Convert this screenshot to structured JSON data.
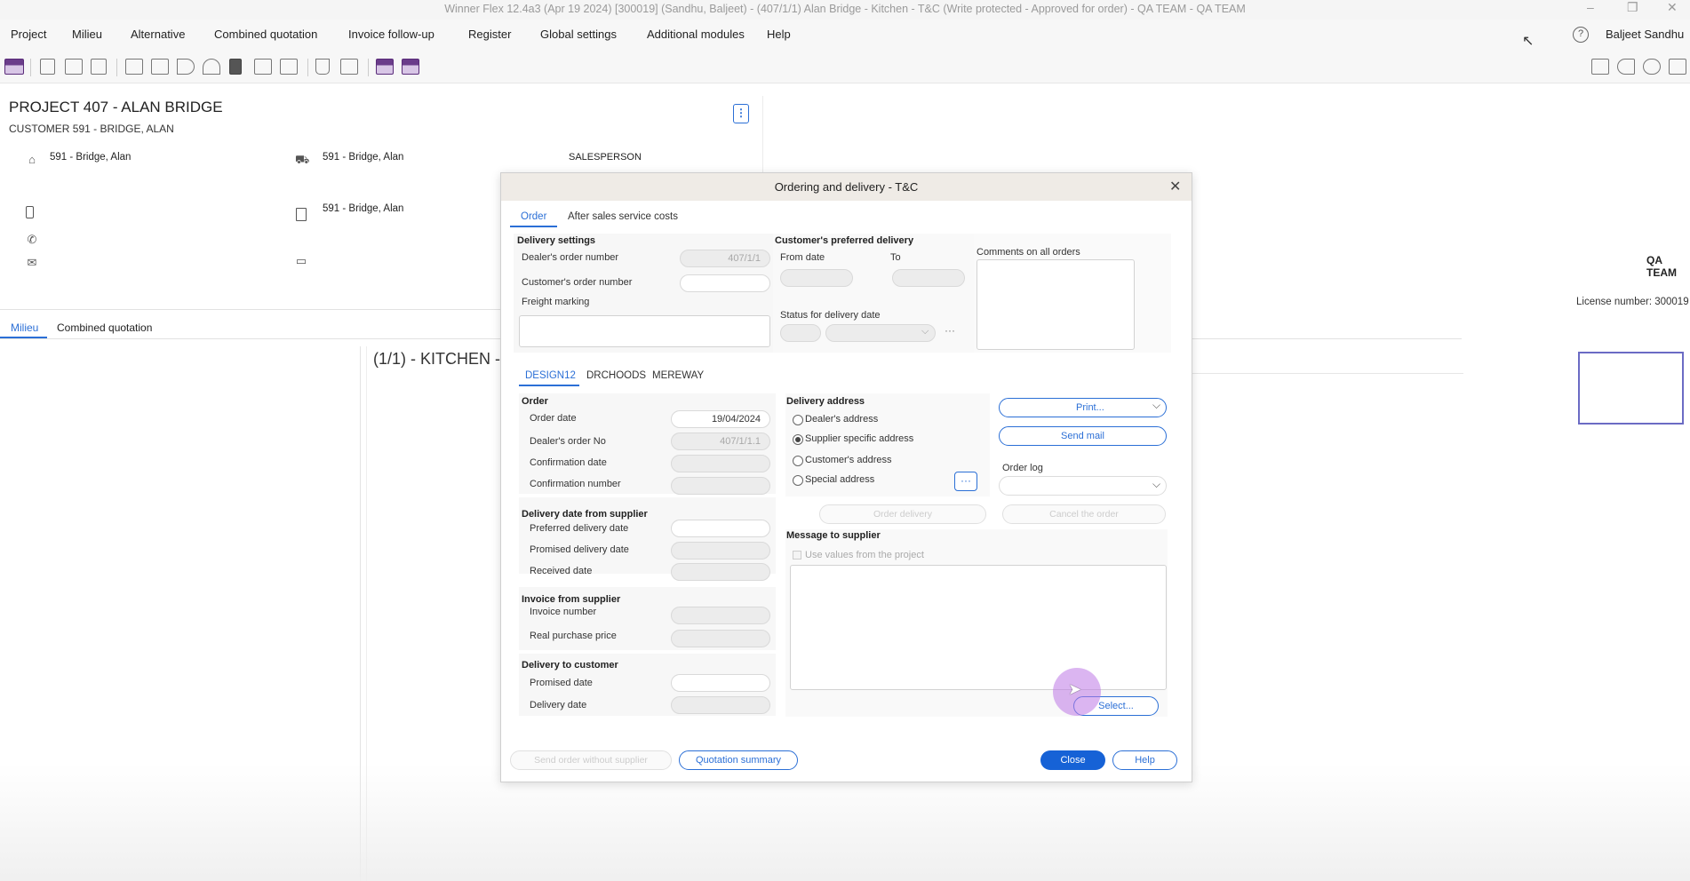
{
  "window": {
    "title": "Winner Flex 12.4a3  (Apr 19 2024) [300019]  (Sandhu, Baljeet) - (407/1/1) Alan Bridge - Kitchen - T&C (Write protected - Approved for order) - QA TEAM  - QA TEAM",
    "minimize": "–",
    "restore": "❐",
    "close": "✕"
  },
  "menu": [
    "Project",
    "Milieu",
    "Alternative",
    "Combined quotation",
    "Invoice follow-up",
    "Register",
    "Global settings",
    "Additional modules",
    "Help"
  ],
  "user": {
    "help_glyph": "?",
    "name": "Baljeet Sandhu"
  },
  "project": {
    "title": "PROJECT 407 - ALAN BRIDGE",
    "customer": "CUSTOMER 591 - BRIDGE, ALAN",
    "kebab": "⋮",
    "home_value": "591 - Bridge, Alan",
    "delivery_value": "591 - Bridge, Alan",
    "invoice_value": "591 - Bridge, Alan",
    "salesperson_label": "SALESPERSON"
  },
  "lower_tabs": {
    "milieu": "Milieu",
    "combined": "Combined quotation"
  },
  "kitchen_title": "(1/1)  - KITCHEN -",
  "right_info": {
    "team": "QA TEAM",
    "license": "License number: 300019"
  },
  "dialog": {
    "title": "Ordering and delivery - T&C",
    "close_glyph": "✕",
    "tabs": {
      "order": "Order",
      "after_sales": "After sales service costs"
    },
    "delivery_settings": {
      "heading": "Delivery settings",
      "dealer_order_label": "Dealer's order number",
      "dealer_order_value": "407/1/1",
      "customer_order_label": "Customer's order number",
      "customer_order_value": "",
      "freight_label": "Freight marking"
    },
    "preferred_delivery": {
      "heading": "Customer's preferred delivery",
      "from_label": "From date",
      "to_label": "To",
      "status_label": "Status for delivery date",
      "more": "···"
    },
    "comments_label": "Comments on all orders",
    "supplier_tabs": {
      "t1": "DESIGN12",
      "t2": "DRCHOODS",
      "t3": "MEREWAY"
    },
    "order": {
      "heading": "Order",
      "order_date_label": "Order date",
      "order_date_value": "19/04/2024",
      "dealer_no_label": "Dealer's order No",
      "dealer_no_value": "407/1/1.1",
      "confirm_date_label": "Confirmation date",
      "confirm_no_label": "Confirmation number"
    },
    "supplier_delivery": {
      "heading": "Delivery date from supplier",
      "preferred_label": "Preferred delivery date",
      "promised_label": "Promised delivery date",
      "received_label": "Received date"
    },
    "invoice": {
      "heading": "Invoice from supplier",
      "number_label": "Invoice number",
      "price_label": "Real purchase price"
    },
    "customer_delivery": {
      "heading": "Delivery to customer",
      "promised_label": "Promised date",
      "delivery_label": "Delivery date"
    },
    "delivery_address": {
      "heading": "Delivery address",
      "dealer": "Dealer's address",
      "supplier": "Supplier specific address",
      "customer": "Customer's address",
      "special": "Special address",
      "more": "···"
    },
    "buttons": {
      "print": "Print...",
      "send_mail": "Send mail",
      "order_log": "Order log",
      "order_delivery": "Order delivery",
      "cancel_order": "Cancel the order",
      "select": "Select...",
      "send_without": "Send order without supplier",
      "quotation_summary": "Quotation summary",
      "close": "Close",
      "help": "Help"
    },
    "message": {
      "heading": "Message to supplier",
      "use_values": "Use values from the project"
    }
  }
}
